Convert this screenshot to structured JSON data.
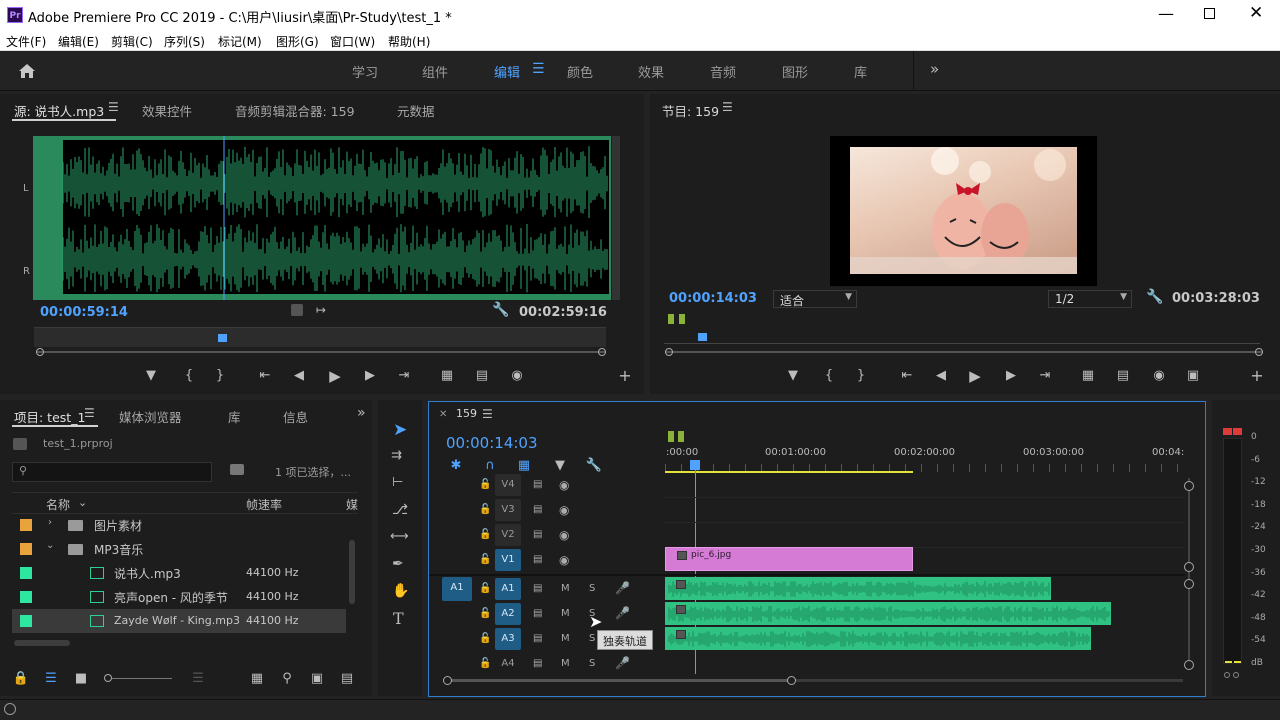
{
  "app": {
    "title": "Adobe Premiere Pro CC 2019 - C:\\用户\\liusir\\桌面\\Pr-Study\\test_1 *",
    "icon_text": "Pr"
  },
  "menu": [
    "文件(F)",
    "编辑(E)",
    "剪辑(C)",
    "序列(S)",
    "标记(M)",
    "图形(G)",
    "窗口(W)",
    "帮助(H)"
  ],
  "workspaces": [
    "学习",
    "组件",
    "编辑",
    "颜色",
    "效果",
    "音频",
    "图形",
    "库"
  ],
  "source": {
    "tabs": [
      "源: 说书人.mp3",
      "效果控件",
      "音频剪辑混合器: 159",
      "元数据"
    ],
    "timecode": "00:00:59:14",
    "duration": "00:02:59:16",
    "ch_left": "L",
    "ch_right": "R"
  },
  "program": {
    "tab": "节目: 159",
    "timecode": "00:00:14:03",
    "fit": "适合",
    "quality": "1/2",
    "duration": "00:03:28:03"
  },
  "project": {
    "tabs": [
      "项目: test_1",
      "媒体浏览器",
      "库",
      "信息"
    ],
    "file": "test_1.prproj",
    "selection": "1 项已选择，...",
    "col_name": "名称",
    "col_rate": "帧速率",
    "col_media": "媒",
    "rows": [
      {
        "name": "图片素材",
        "rate": "",
        "type": "folder",
        "color": "#e8a33c"
      },
      {
        "name": "MP3音乐",
        "rate": "",
        "type": "folder",
        "color": "#e8a33c"
      },
      {
        "name": "说书人.mp3",
        "rate": "44100 Hz",
        "type": "audio",
        "color": "#2ee6a0"
      },
      {
        "name": "亮声open - 风的季节",
        "rate": "44100 Hz",
        "type": "audio",
        "color": "#2ee6a0"
      },
      {
        "name": "Zayde Wølf - King.mp3",
        "rate": "44100 Hz",
        "type": "audio",
        "color": "#2ee6a0"
      }
    ]
  },
  "timeline": {
    "tab": "159",
    "timecode": "00:00:14:03",
    "ruler": [
      ":00:00",
      "00:01:00:00",
      "00:02:00:00",
      "00:03:00:00",
      "00:04:"
    ],
    "video_tracks": [
      "V4",
      "V3",
      "V2",
      "V1"
    ],
    "audio_tracks": [
      "A1",
      "A2",
      "A3",
      "A4"
    ],
    "source_patch": "A1",
    "mute": "M",
    "solo": "S",
    "clip_v1": "pic_6.jpg",
    "tooltip": "独奏轨道"
  },
  "meter": {
    "labels": [
      "0",
      "-6",
      "-12",
      "-18",
      "-24",
      "-30",
      "-36",
      "-42",
      "-48",
      "-54",
      "dB"
    ]
  }
}
